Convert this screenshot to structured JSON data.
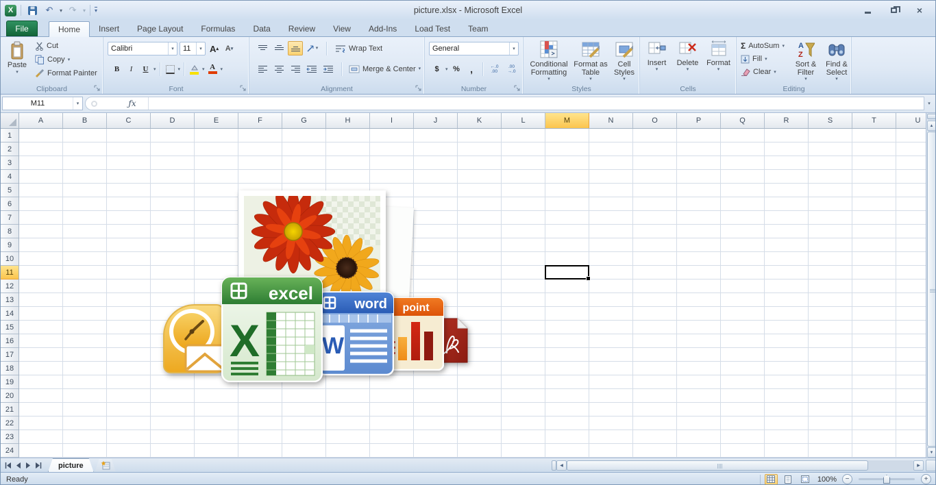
{
  "window": {
    "title": "picture.xlsx  -  Microsoft Excel"
  },
  "icons": {
    "caret": "▾",
    "left_arrow": "◀",
    "right_arrow": "▶",
    "up_arrow": "▲",
    "down_arrow": "▼",
    "close": "×",
    "help": "?",
    "sigma": "Σ",
    "undo": "↶",
    "redo": "↷",
    "excel_logo": "X",
    "minus": "−",
    "plus": "+"
  },
  "ribbon": {
    "tabs": [
      "File",
      "Home",
      "Insert",
      "Page Layout",
      "Formulas",
      "Data",
      "Review",
      "View",
      "Add-Ins",
      "Load Test",
      "Team"
    ],
    "active_tab": "Home",
    "clipboard": {
      "title": "Clipboard",
      "paste": "Paste",
      "cut": "Cut",
      "copy": "Copy",
      "format_painter": "Format Painter"
    },
    "font": {
      "title": "Font",
      "family": "Calibri",
      "size": "11",
      "bold": "B",
      "italic": "I",
      "underline": "U",
      "grow": "A",
      "shrink": "A"
    },
    "alignment": {
      "title": "Alignment",
      "wrap_text": "Wrap Text",
      "merge_center": "Merge & Center"
    },
    "number": {
      "title": "Number",
      "format": "General",
      "currency": "$",
      "percent": "%",
      "comma": ",",
      "inc_top": "←.0",
      "inc_bot": ".00",
      "dec_top": ".00",
      "dec_bot": "→.0"
    },
    "styles": {
      "title": "Styles",
      "conditional_formatting": "Conditional Formatting",
      "format_as_table": "Format as Table",
      "cell_styles": "Cell Styles"
    },
    "cells": {
      "title": "Cells",
      "insert": "Insert",
      "delete": "Delete",
      "format": "Format"
    },
    "editing": {
      "title": "Editing",
      "autosum": "AutoSum",
      "fill": "Fill",
      "clear": "Clear",
      "sort_filter": "Sort & Filter",
      "find_select": "Find & Select"
    }
  },
  "formula_bar": {
    "name_box": "M11",
    "fx_label": "ƒx",
    "formula": ""
  },
  "grid": {
    "columns": [
      "A",
      "B",
      "C",
      "D",
      "E",
      "F",
      "G",
      "H",
      "I",
      "J",
      "K",
      "L",
      "M",
      "N",
      "O",
      "P",
      "Q",
      "R",
      "S",
      "T",
      "U"
    ],
    "row_count": 24,
    "selected_cell": "M11",
    "selected_column": "M",
    "selected_row": 11
  },
  "sheet_tabs": {
    "tabs": [
      "picture"
    ],
    "active": "picture"
  },
  "status_bar": {
    "status": "Ready",
    "zoom": "100%"
  },
  "embedded_picture": {
    "description": "Collage of Office application icons with flower photo",
    "excel_label": "excel",
    "word_label": "word",
    "point_label": "point",
    "excel_letter": "X",
    "word_letter": "W"
  },
  "colors": {
    "file_tab_green": "#1e7145",
    "selected_header_amber": "#fbc54e",
    "ribbon_blue": "#dfe9f5",
    "grid_line": "#d5dde8"
  }
}
